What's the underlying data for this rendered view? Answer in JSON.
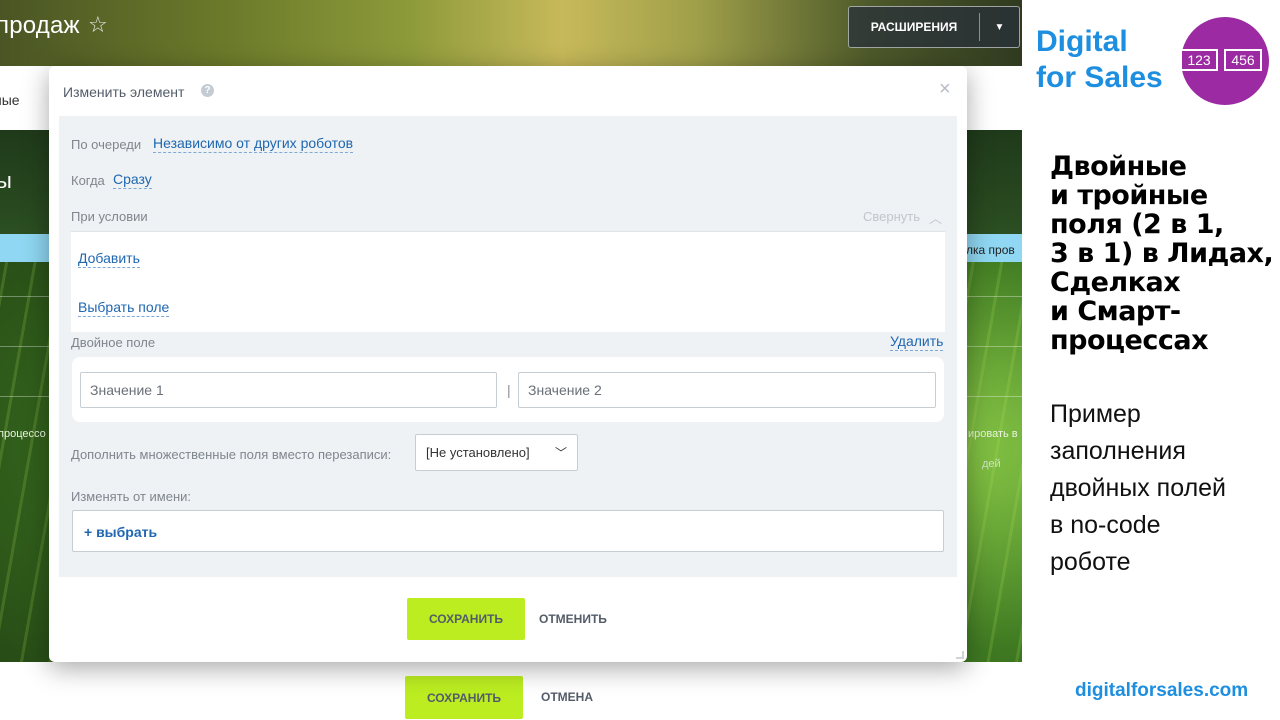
{
  "background": {
    "title_fragment": "продаж",
    "extensions_button": "РАСШИРЕНИЯ",
    "tab_fragment": "ные",
    "section_fragment": "ы",
    "strip_fragment": "лка пров",
    "left_fragment": "процессо",
    "right_fragment_1": "ировать в",
    "right_fragment_2": "дей",
    "save_button": "СОХРАНИТЬ",
    "cancel_button": "ОТМЕНА"
  },
  "modal": {
    "title": "Изменить элемент",
    "help_icon": "?",
    "queue_label": "По очереди",
    "queue_value": "Независимо от других роботов",
    "when_label": "Когда",
    "when_value": "Сразу",
    "condition_label": "При условии",
    "collapse_label": "Свернуть",
    "add_link": "Добавить",
    "choose_field_link": "Выбрать поле",
    "double_field_label": "Двойное поле",
    "delete_link": "Удалить",
    "value1_placeholder": "Значение 1",
    "value2_placeholder": "Значение 2",
    "separator": "|",
    "supplement_label": "Дополнить множественные поля вместо перезаписи:",
    "supplement_value": "[Не установлено]",
    "change_from_label": "Изменять от имени:",
    "pick_button": "+ выбрать",
    "save_button": "СОХРАНИТЬ",
    "cancel_button": "ОТМЕНИТЬ"
  },
  "promo": {
    "brand_line1": "Digital",
    "brand_line2": "for Sales",
    "logo_text1": "123",
    "logo_text2": "456",
    "headline": [
      "Двойные",
      "и тройные",
      "поля (2 в 1,",
      "3 в 1) в Лидах,",
      "Сделках",
      "и Смарт-",
      "процессах"
    ],
    "subtext": [
      "Пример",
      "заполнения",
      "двойных полей",
      "в no-code",
      "роботе"
    ],
    "site": "digitalforsales.com"
  },
  "colors": {
    "accent_green": "#bbed21",
    "link_blue": "#2067b0",
    "brand_blue": "#1e8fe0",
    "logo_purple": "#9b2aa3"
  }
}
